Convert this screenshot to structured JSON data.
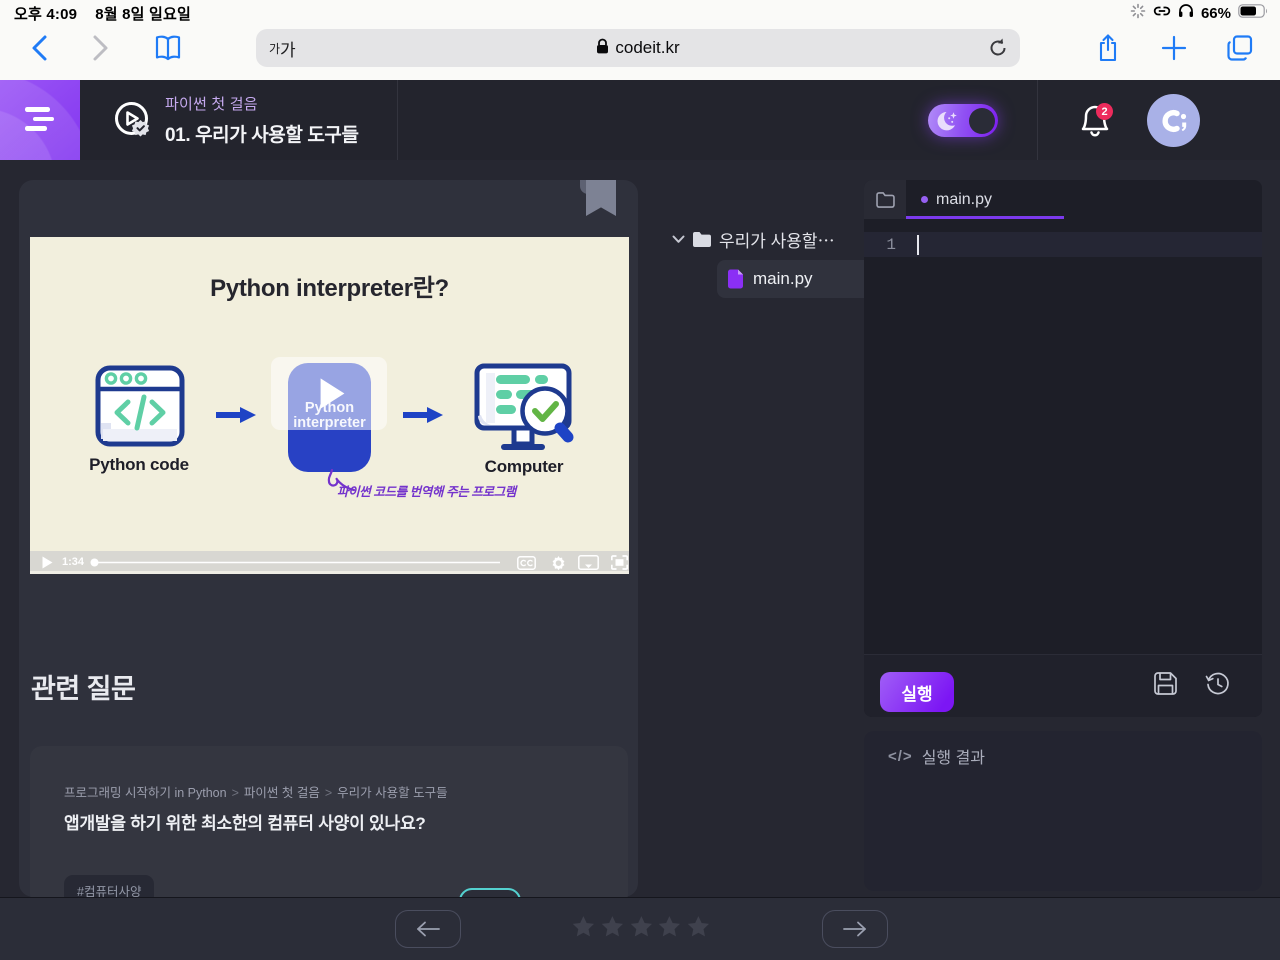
{
  "status_bar": {
    "time": "오후 4:09",
    "date": "8월 8일 일요일",
    "battery": "66%"
  },
  "browser": {
    "reader_small": "가",
    "reader_large": "가",
    "url": "codeit.kr"
  },
  "header": {
    "course_subtitle": "파이썬 첫 걸음",
    "lesson_title": "01. 우리가 사용할 도구들",
    "notification_count": "2"
  },
  "video": {
    "current_time": "1:34",
    "slide": {
      "title": "Python interpreter란?",
      "step1_label": "Python code",
      "step2_line1": "Python",
      "step2_line2": "interpreter",
      "step3_label": "Computer",
      "annotation": "파이썬 코드를 번역해 주는 프로그램"
    }
  },
  "related": {
    "heading": "관련 질문",
    "breadcrumb": {
      "part1": "프로그래밍 시작하기 in Python",
      "sep1": ">",
      "part2": "파이썬 첫 걸음",
      "sep2": ">",
      "part3": "우리가 사용할 도구들"
    },
    "question": "앱개발을 하기 위한 최소한의 컴퓨터 사양이 있나요?",
    "tag": "#컴퓨터사양"
  },
  "ide": {
    "folder_name": "우리가 사용할⋯",
    "file_name": "main.py",
    "tab_name": "main.py",
    "line_number": "1",
    "run_label": "실행",
    "output_icon": "</>",
    "output_title": "실행 결과"
  },
  "colors": {
    "accent_purple": "#7c3aed",
    "toggle_purple": "#8b3ff2",
    "badge_red": "#ed2b5c",
    "avatar_periwinkle": "#a9b1e7",
    "slide_cream": "#f2efdd",
    "diagram_navy": "#1e3a8f",
    "diagram_blue": "#2841c4",
    "diagram_teal": "#5fcfa5",
    "check_green": "#62b545",
    "annotation_purple": "#7433cc",
    "question_teal": "#54d1cf",
    "safari_blue": "#1f7bf6"
  }
}
